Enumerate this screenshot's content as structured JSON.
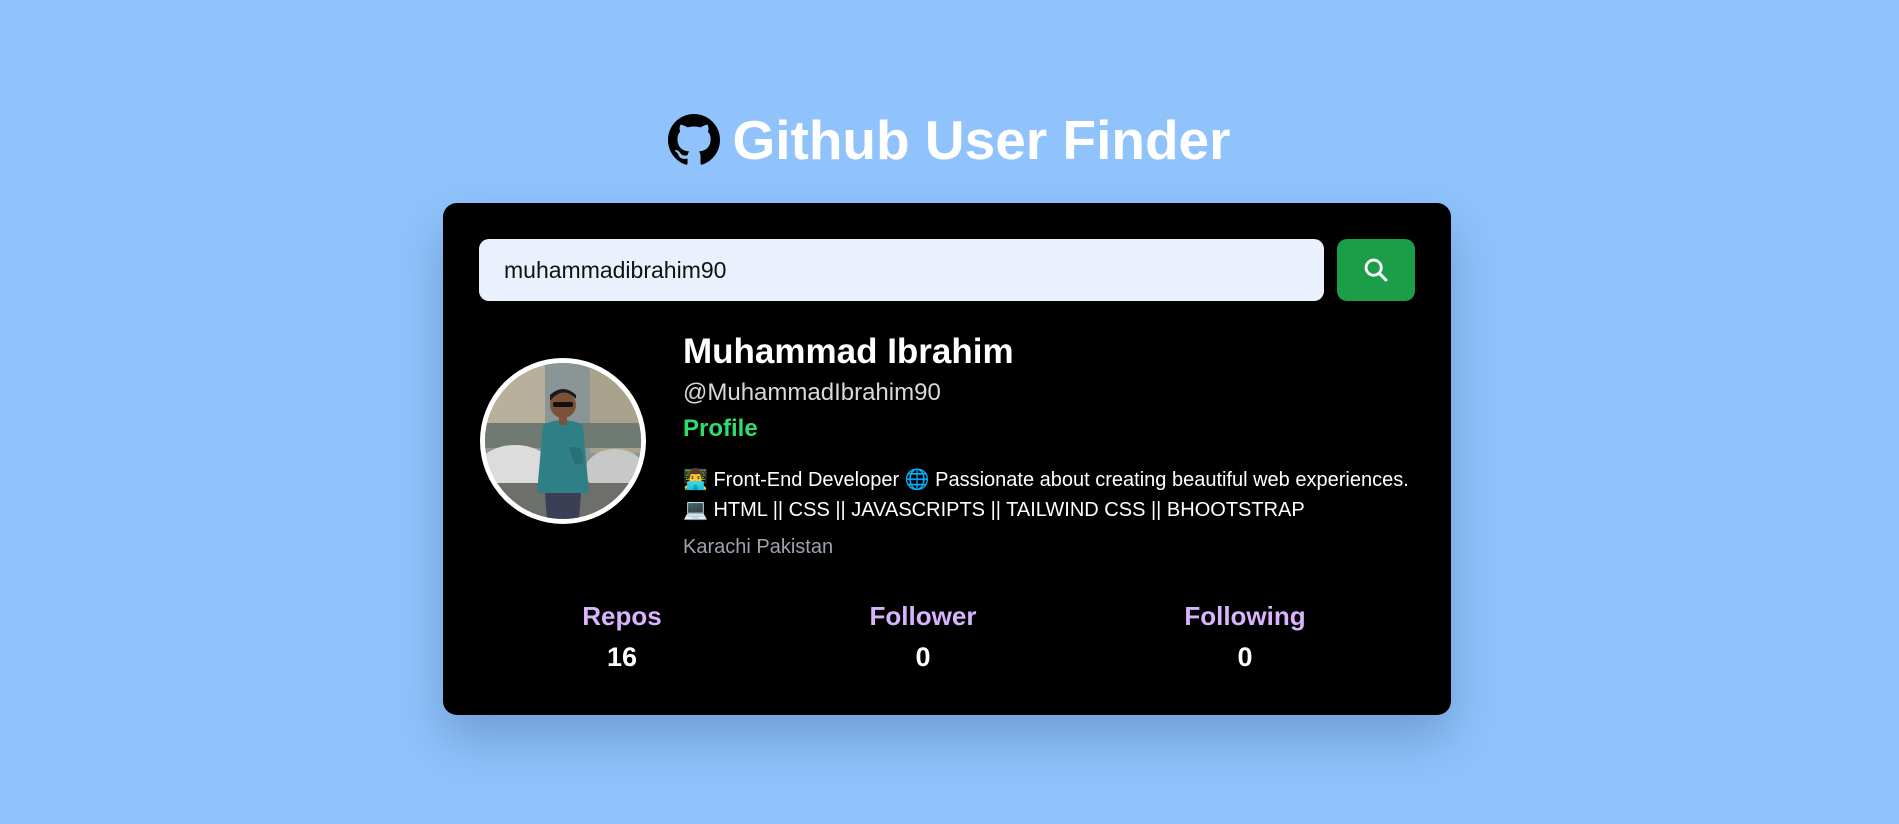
{
  "app": {
    "title": "Github User Finder",
    "logo_icon": "github-icon"
  },
  "search": {
    "value": "muhammadibrahim90",
    "placeholder": "",
    "button_icon": "search-icon",
    "button_color": "#1c9d48"
  },
  "profile": {
    "name": "Muhammad Ibrahim",
    "handle": "@MuhammadIbrahim90",
    "link_label": "Profile",
    "link_color": "#2fdc6c",
    "bio": "👨‍💻 Front-End Developer 🌐 Passionate about creating beautiful web experiences. 💻 HTML || CSS || JAVASCRIPTS || TAILWIND CSS || BHOOTSTRAP",
    "location": "Karachi Pakistan"
  },
  "stats": {
    "repos": {
      "label": "Repos",
      "value": "16"
    },
    "followers": {
      "label": "Follower",
      "value": "0"
    },
    "following": {
      "label": "Following",
      "value": "0"
    }
  },
  "colors": {
    "background": "#90c3fb",
    "card": "#000000",
    "stat_label": "#d8b4fe"
  }
}
